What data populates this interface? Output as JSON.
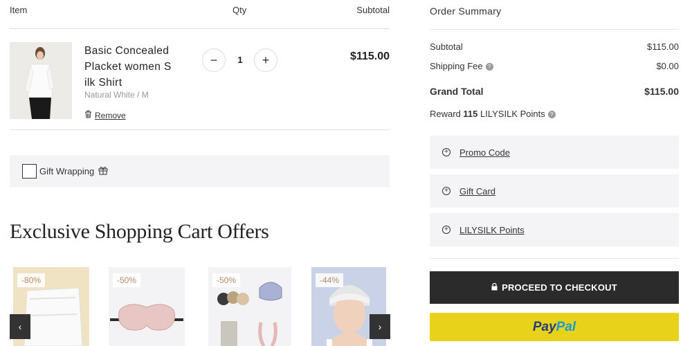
{
  "cart": {
    "headers": {
      "item": "Item",
      "qty": "Qty",
      "subtotal": "Subtotal"
    },
    "item": {
      "name": "Basic Concealed Placket women S ilk Shirt",
      "variant": "Natural White / M",
      "remove_label": "Remove",
      "quantity": "1",
      "minus": "−",
      "plus": "+",
      "line_total": "$115.00"
    },
    "gift_wrapping_label": "Gift Wrapping"
  },
  "offers": {
    "title": "Exclusive Shopping Cart Offers",
    "cards": [
      {
        "discount": "-80%"
      },
      {
        "discount": "-50%"
      },
      {
        "discount": "-50%"
      },
      {
        "discount": "-44%"
      }
    ],
    "prev": "‹",
    "next": "›"
  },
  "summary": {
    "title": "Order Summary",
    "subtotal_label": "Subtotal",
    "subtotal_value": "$115.00",
    "shipping_label": "Shipping Fee",
    "shipping_value": "$0.00",
    "grand_label": "Grand Total",
    "grand_value": "$115.00",
    "reward_prefix": "Reward",
    "reward_points": "115",
    "reward_suffix": "LILYSILK Points",
    "accordions": [
      "Promo Code",
      "Gift Card",
      "LILYSILK Points"
    ],
    "checkout_label": "PROCEED TO CHECKOUT",
    "paypal_part1": "Pay",
    "paypal_part2": "Pal"
  },
  "colors": {
    "checkout_bg": "#2b2b2b",
    "paypal_bg": "#e8d31a",
    "badge_text": "#b98866",
    "panel_bg": "#f4f4f6"
  },
  "icons": [
    "minus-icon",
    "plus-icon",
    "trash-icon",
    "gift-icon",
    "info-icon",
    "circle-plus-icon",
    "lock-icon",
    "chevron-left-icon",
    "chevron-right-icon"
  ]
}
